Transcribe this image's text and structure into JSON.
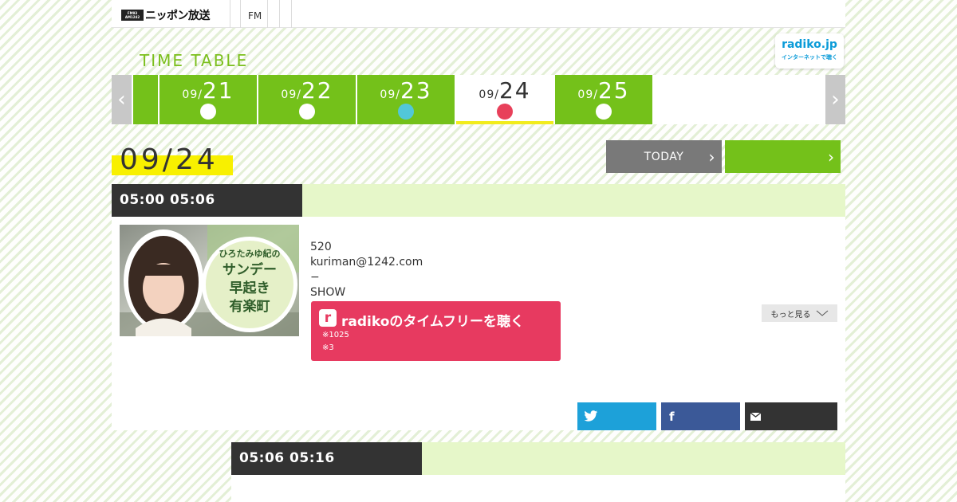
{
  "header": {
    "logo_badge_top": "FM93",
    "logo_badge_bottom": "AM1242",
    "logo_text": "ニッポン放送",
    "nav_fm": "FM"
  },
  "timetable_title": "TIME TABLE",
  "radiko_badge": {
    "main": "radiko.jp",
    "sub": "インターネットで聴く"
  },
  "nav_arrows": {
    "prev": "‹",
    "next": "›"
  },
  "date_tabs": [
    {
      "month": "09/",
      "day": "",
      "dot_color": ""
    },
    {
      "month": "09/",
      "day": "21",
      "dot_color": "#ffffff"
    },
    {
      "month": "09/",
      "day": "22",
      "dot_color": "#ffffff"
    },
    {
      "month": "09/",
      "day": "23",
      "dot_color": "#52c7d8"
    },
    {
      "month": "09/",
      "day": "24",
      "dot_color": "#e8405a",
      "active": true
    },
    {
      "month": "09/",
      "day": "25",
      "dot_color": "#ffffff"
    }
  ],
  "current_date": "09/24",
  "today_button": "TODAY",
  "next_button": "",
  "chevron": "›",
  "programs": [
    {
      "time": "05:00  05:06",
      "info_lines": [
        "520",
        "kuriman@1242.com",
        "−",
        "SHOW"
      ],
      "radiko_label": "radikoのタイムフリーを聴く",
      "radiko_icon": "r",
      "radiko_notes": [
        "※1025",
        "※3"
      ],
      "more_label": "もっと見る",
      "thumbnail_text": [
        "ひろたみゆ紀の",
        "サンデー",
        "早起き",
        "有楽町"
      ]
    },
    {
      "time": "05:06  05:16"
    }
  ],
  "share": {
    "twitter_icon": "twitter-icon",
    "facebook_icon": "f",
    "mail_icon": "mail-icon"
  },
  "colors": {
    "green": "#74c11a",
    "dark": "#333333",
    "light_green": "#e6f7c9",
    "yellow": "#f8f000",
    "radiko_pink": "#e73a60",
    "twitter": "#1da1d9",
    "facebook": "#3b5998"
  }
}
